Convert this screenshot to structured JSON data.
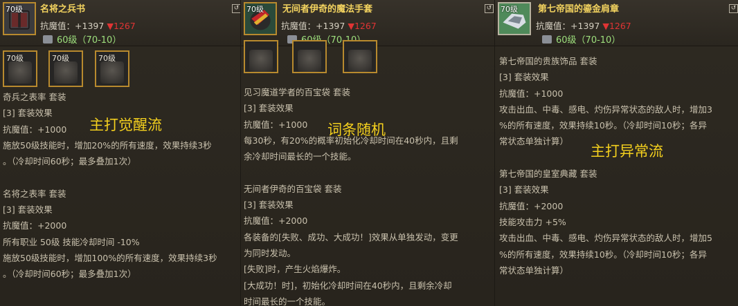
{
  "panels": [
    {
      "icon_level": "70级",
      "name": "名将之兵书",
      "stat_label": "抗魔值",
      "stat_up": "+1397",
      "stat_down": "1267",
      "grade": "60级（70-10）",
      "slots": [
        "70级",
        "70级",
        "70级"
      ],
      "lines": [
        "奇兵之表率  套装",
        "[3] 套装效果",
        "抗魔值：+1000",
        "施放50级技能时，增加20%的所有速度，效果持续3秒",
        "。（冷却时间60秒；最多叠加1次）",
        "",
        "名将之表率  套装",
        "[3] 套装效果",
        "抗魔值：+2000",
        "所有职业 50级 技能冷却时间 -10%",
        "施放50级技能时，增加100%的所有速度，效果持续3秒",
        "。（冷却时间60秒；最多叠加1次）"
      ],
      "overlay": "主打觉醒流"
    },
    {
      "icon_level": "70级",
      "name": "无间者伊奇的魔法手套",
      "stat_label": "抗魔值",
      "stat_up": "+1397",
      "stat_down": "1267",
      "grade": "60级（70-10）",
      "lines": [
        "见习魔道学者的百宝袋  套装",
        "[3] 套装效果",
        "抗魔值：+1000",
        "每30秒，有20%的概率初始化冷却时间在40秒内，且剩",
        "余冷却时间最长的一个技能。",
        "",
        "无间者伊奇的百宝袋  套装",
        "[3] 套装效果",
        "抗魔值：+2000",
        "各装备的[失败、成功、大成功！]效果从单独发动，变更",
        "为同时发动。",
        "[失败]时，产生火焰爆炸。",
        "[大成功！时]，初始化冷却时间在40秒内，且剩余冷却",
        "时间最长的一个技能。"
      ],
      "overlay": "词条随机"
    },
    {
      "icon_level": "70级",
      "name": "第七帝国的鎏金肩章",
      "stat_label": "抗魔值",
      "stat_up": "+1397",
      "stat_down": "1267",
      "grade": "60级（70-10）",
      "lines": [
        "第七帝国的贵族饰品  套装",
        "[3] 套装效果",
        "抗魔值：+1000",
        "攻击出血、中毒、感电、灼伤异常状态的敌人时，增加3",
        "%的所有速度，效果持续10秒。（冷却时间10秒；各异",
        "常状态单独计算）",
        "",
        "第七帝国的皇室典藏  套装",
        "[3] 套装效果",
        "抗魔值：+2000",
        "技能攻击力 +5%",
        "攻击出血、中毒、感电、灼伤异常状态的敌人时，增加5",
        "%的所有速度，效果持续10秒。（冷却时间10秒；各异",
        "常状态单独计算）"
      ],
      "overlay": "主打异常流"
    }
  ]
}
